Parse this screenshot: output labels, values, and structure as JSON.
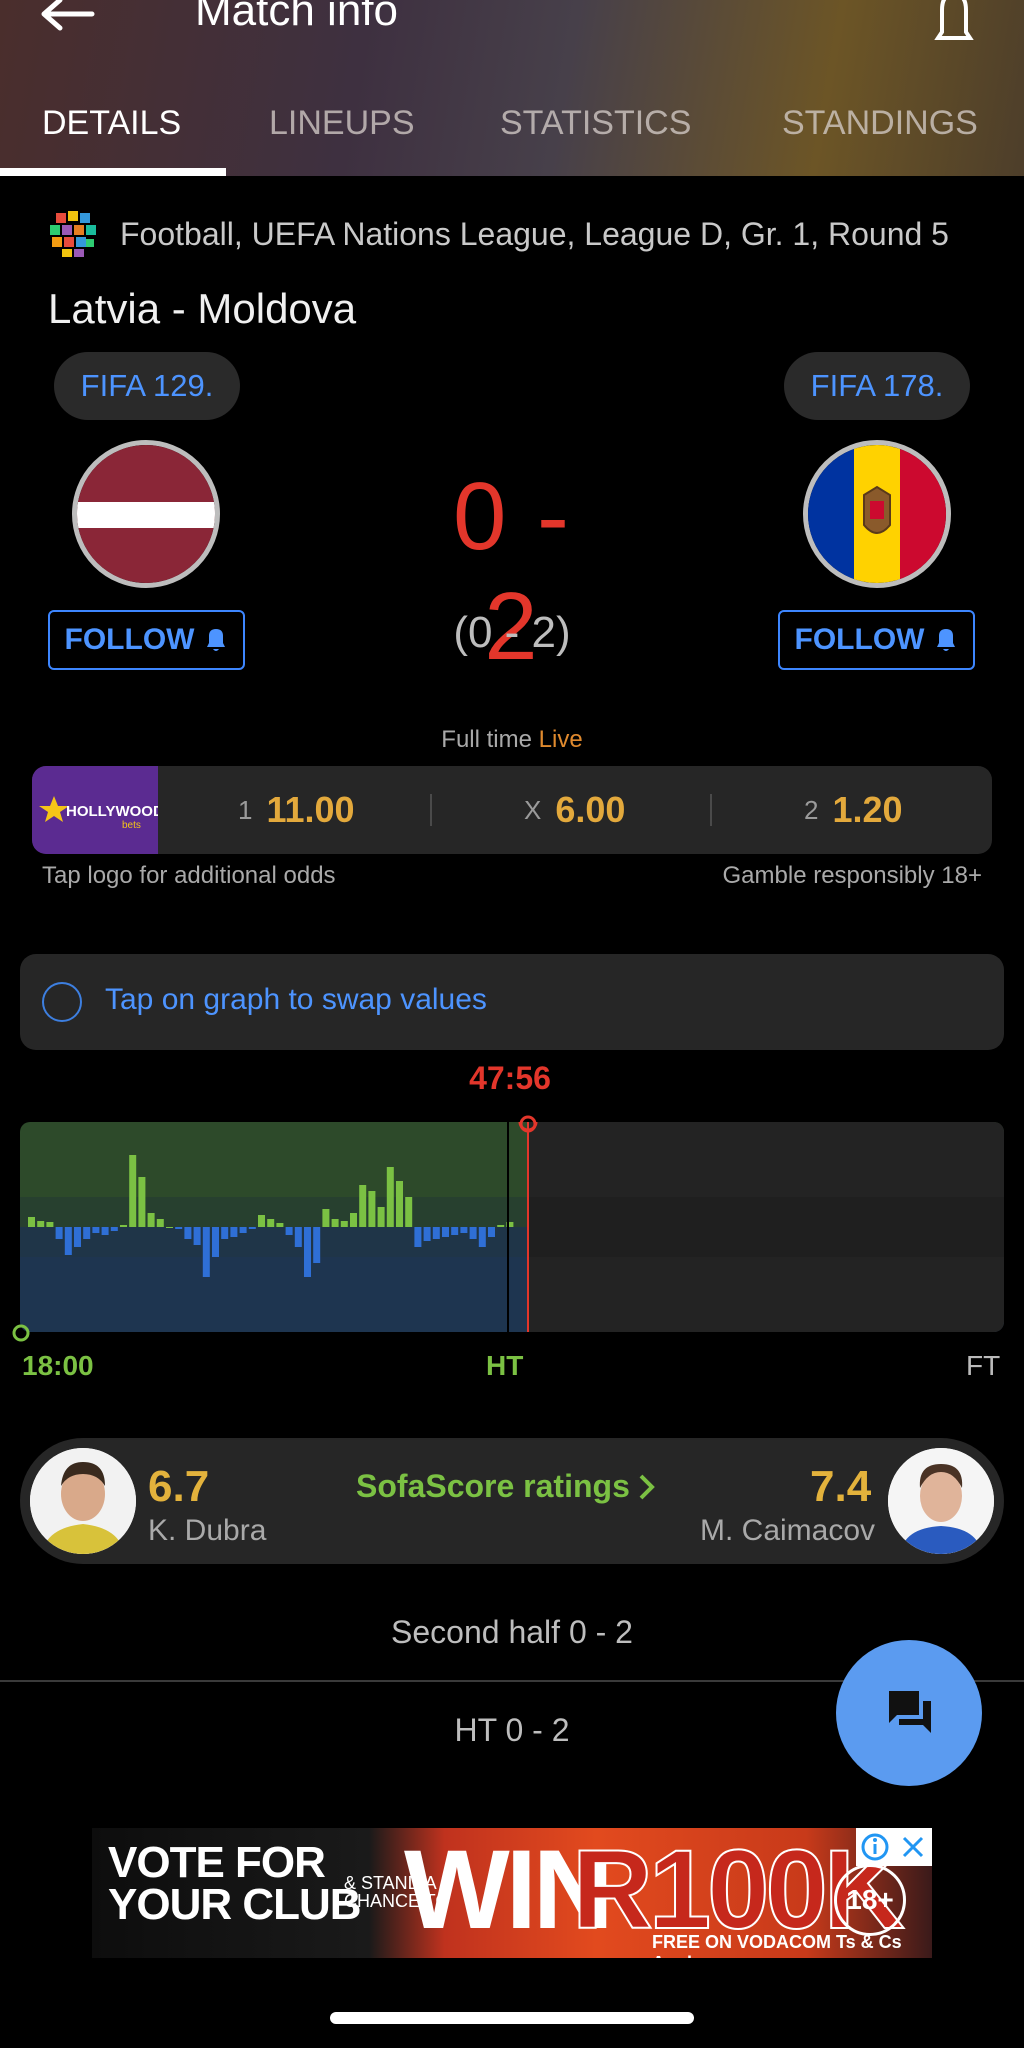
{
  "header": {
    "title": "Match info"
  },
  "tabs": [
    {
      "label": "DETAILS",
      "active": true
    },
    {
      "label": "LINEUPS"
    },
    {
      "label": "STATISTICS"
    },
    {
      "label": "STANDINGS"
    }
  ],
  "event": {
    "league": "Football, UEFA Nations League, League D, Gr. 1, Round 5",
    "match_name": "Latvia - Moldova"
  },
  "home": {
    "rank": "FIFA 129.",
    "follow_label": "FOLLOW"
  },
  "away": {
    "rank": "FIFA 178.",
    "follow_label": "FOLLOW"
  },
  "score": {
    "main": "0 - 2",
    "halftime": "(0 - 2)"
  },
  "status": {
    "text": "Full time",
    "live": "Live"
  },
  "odds": {
    "provider_logo": "HOLLYWOOD",
    "provider_sub": "bets",
    "items": [
      {
        "key": "1",
        "value": "11.00"
      },
      {
        "key": "X",
        "value": "6.00"
      },
      {
        "key": "2",
        "value": "1.20"
      }
    ],
    "note_left": "Tap logo for additional odds",
    "note_right": "Gamble responsibly 18+"
  },
  "graph": {
    "swap_label": "Tap on graph to swap values",
    "clock": "47:56",
    "start_label": "18:00",
    "ht_label": "HT",
    "ft_label": "FT",
    "momentum": [
      0.1,
      0.06,
      0.05,
      -0.12,
      -0.28,
      -0.2,
      -0.12,
      -0.06,
      -0.08,
      -0.04,
      0.02,
      0.72,
      0.5,
      0.14,
      0.08,
      0,
      -0.02,
      -0.12,
      -0.18,
      -0.5,
      -0.3,
      -0.12,
      -0.1,
      -0.06,
      -0.02,
      0.12,
      0.08,
      0.04,
      -0.08,
      -0.2,
      -0.5,
      -0.36,
      0.18,
      0.08,
      0.06,
      0.14,
      0.42,
      0.36,
      0.2,
      0.6,
      0.46,
      0.3,
      -0.2,
      -0.14,
      -0.12,
      -0.1,
      -0.08,
      -0.06,
      -0.12,
      -0.2,
      -0.1,
      0.02,
      0.05
    ]
  },
  "ratings": {
    "home_value": "6.7",
    "home_player": "K. Dubra",
    "link_label": "SofaScore ratings",
    "away_value": "7.4",
    "away_player": "M. Caimacov"
  },
  "periods": {
    "second_half": "Second half 0 - 2",
    "half_time": "HT 0 - 2"
  },
  "ad": {
    "line1": "VOTE FOR",
    "line2": "YOUR CLUB",
    "small1": "& STAND A",
    "small2": "CHANCE TO",
    "win": "WIN",
    "prize": "R100K",
    "age": "18+",
    "footer": "FREE ON VODACOM Ts & Cs Apply"
  },
  "colors": {
    "accent_blue": "#4d94ff",
    "score_red": "#e3362b",
    "odds_orange": "#e3a93c",
    "graph_green": "#7bc143",
    "graph_blue": "#2f6fd6"
  }
}
